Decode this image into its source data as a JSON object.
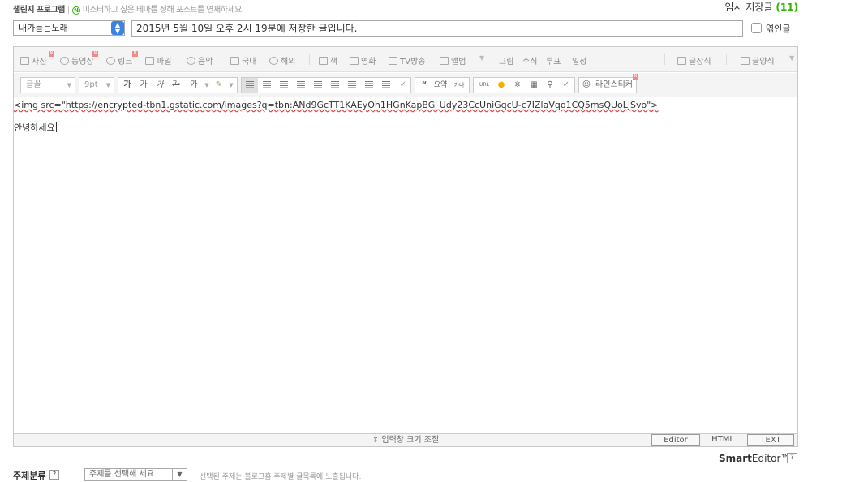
{
  "header": {
    "challenge_title": "챌린지 프로그램",
    "challenge_desc": "미스터하고 싶은 테마를 정해 포스트를 연재하세요.",
    "temp_save_label": "임시 저장글",
    "temp_save_count": "(11)"
  },
  "title_row": {
    "category": "내가듣는노래",
    "title_value": "2015년 5월 10일 오후 2시 19분에 저장한 글입니다.",
    "recipient_label": "엮인글"
  },
  "toolbar1": {
    "items": [
      "사진",
      "동영상",
      "링크",
      "파일",
      "음악",
      "국내",
      "해외",
      "책",
      "영화",
      "TV방송",
      "앨범",
      "그림",
      "수식",
      "투표",
      "일정"
    ],
    "right_items": [
      "글장식",
      "글양식"
    ]
  },
  "toolbar2": {
    "font_family": "글꼴",
    "font_size": "9pt",
    "format_buttons": [
      "가",
      "가",
      "가",
      "가",
      "가"
    ],
    "quote_label": "“",
    "summary_label": "요약",
    "hanja_label": "가나",
    "url_label": "URL",
    "sticker_label": "라인스티커"
  },
  "content": {
    "html_line": "<img src=\"https://encrypted-tbn1.gstatic.com/images?q=tbn:ANd9GcTT1KAEyOh1HGnKapBG_Udy23CcUniGqcU-c7IZlaVqo1CQ5msQUoLjSvo\">",
    "text_line": "안녕하세요"
  },
  "footer": {
    "resize_label": "⇕ 입력창 크기 조절",
    "mode_tabs": [
      "Editor",
      "HTML",
      "TEXT"
    ],
    "brand_smart": "Smart",
    "brand_editor": "Editor™",
    "help_label": "?"
  },
  "bottom": {
    "topic_label": "주제분류",
    "topic_help": "?",
    "topic_placeholder": "주제를 선택해 세요",
    "hint": "선택된 주제는 블로그홈 주제별 글목록에 노출됩니다."
  },
  "colors": {
    "accent_green": "#2db400",
    "select_blue": "#3b82e6",
    "new_badge": "#f28a8a"
  }
}
